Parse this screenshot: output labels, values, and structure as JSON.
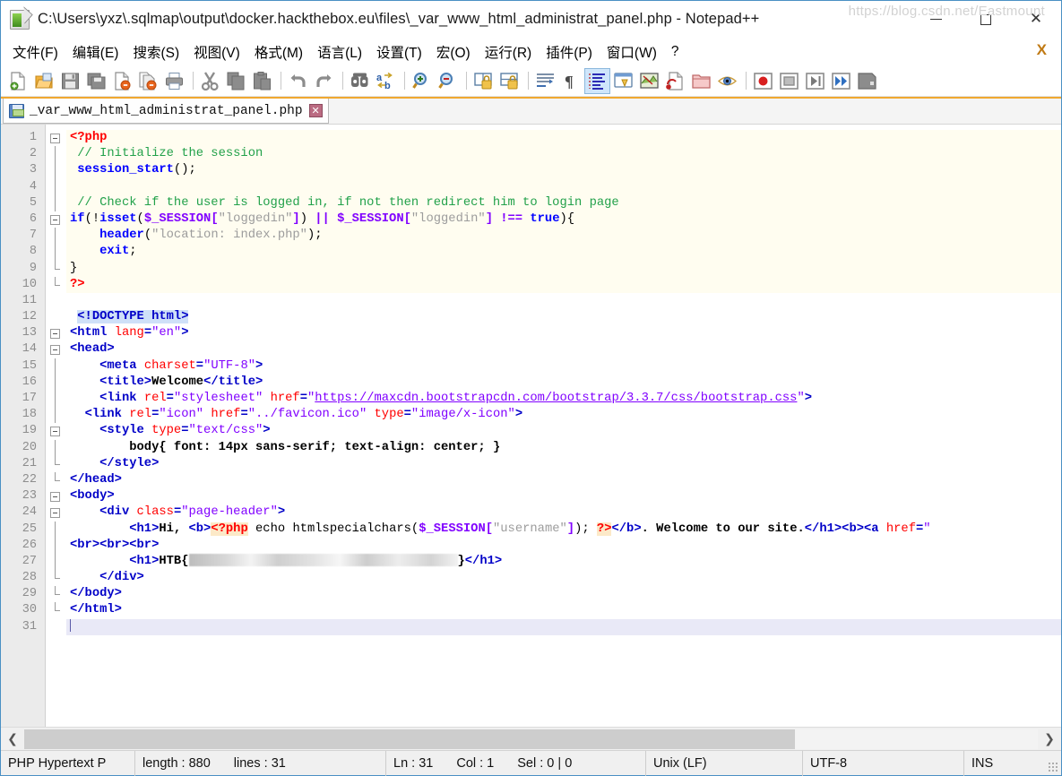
{
  "window": {
    "title": "C:\\Users\\yxz\\.sqlmap\\output\\docker.hackthebox.eu\\files\\_var_www_html_administrat_panel.php - Notepad++",
    "app_icon": "notepad-plus-plus-icon",
    "minimize_label": "Minimize",
    "maximize_label": "Maximize",
    "close_label": "Close"
  },
  "menubar": {
    "items": [
      {
        "label": "文件(F)",
        "name": "menu-file"
      },
      {
        "label": "编辑(E)",
        "name": "menu-edit"
      },
      {
        "label": "搜索(S)",
        "name": "menu-search"
      },
      {
        "label": "视图(V)",
        "name": "menu-view"
      },
      {
        "label": "格式(M)",
        "name": "menu-format"
      },
      {
        "label": "语言(L)",
        "name": "menu-language"
      },
      {
        "label": "设置(T)",
        "name": "menu-settings"
      },
      {
        "label": "宏(O)",
        "name": "menu-macro"
      },
      {
        "label": "运行(R)",
        "name": "menu-run"
      },
      {
        "label": "插件(P)",
        "name": "menu-plugins"
      },
      {
        "label": "窗口(W)",
        "name": "menu-window"
      },
      {
        "label": "?",
        "name": "menu-help"
      }
    ],
    "close_document_label": "X"
  },
  "toolbar": {
    "icons": [
      "new-file-icon",
      "open-file-icon",
      "save-icon",
      "save-all-icon",
      "close-file-icon",
      "close-all-icon",
      "print-icon",
      "cut-icon",
      "copy-icon",
      "paste-icon",
      "undo-icon",
      "redo-icon",
      "find-icon",
      "replace-icon",
      "zoom-in-icon",
      "zoom-out-icon",
      "sync-vertical-scroll-icon",
      "sync-horizontal-scroll-icon",
      "word-wrap-icon",
      "show-all-characters-icon",
      "indent-guide-icon",
      "user-defined-dialog-icon",
      "document-map-icon",
      "function-list-icon",
      "folder-as-workspace-icon",
      "monitoring-icon",
      "record-macro-icon",
      "stop-recording-icon",
      "playback-macro-icon",
      "run-macro-multiple-icon",
      "save-macro-icon"
    ]
  },
  "tab": {
    "label": "_var_www_html_administrat_panel.php",
    "icon": "saved-document-icon",
    "close_label": "✕"
  },
  "editor": {
    "total_lines": 31,
    "current_line": 31,
    "lines": [
      {
        "n": 1,
        "fold": "open",
        "tokens": [
          {
            "t": "phptag",
            "s": "<?php"
          }
        ]
      },
      {
        "n": 2,
        "fold": "bar",
        "tokens": [
          {
            "t": "plain",
            "s": " "
          },
          {
            "t": "comment",
            "s": "// Initialize the session"
          }
        ]
      },
      {
        "n": 3,
        "fold": "bar",
        "tokens": [
          {
            "t": "plain",
            "s": " "
          },
          {
            "t": "func",
            "s": "session_start"
          },
          {
            "t": "plain",
            "s": "();"
          }
        ]
      },
      {
        "n": 4,
        "fold": "bar",
        "tokens": []
      },
      {
        "n": 5,
        "fold": "bar",
        "tokens": [
          {
            "t": "plain",
            "s": " "
          },
          {
            "t": "comment",
            "s": "// Check if the user is logged in, if not then redirect him to login page"
          }
        ]
      },
      {
        "n": 6,
        "fold": "open",
        "tokens": [
          {
            "t": "kw",
            "s": "if"
          },
          {
            "t": "plain",
            "s": "(!"
          },
          {
            "t": "func",
            "s": "isset"
          },
          {
            "t": "plain",
            "s": "("
          },
          {
            "t": "var",
            "s": "$_SESSION"
          },
          {
            "t": "op",
            "s": "["
          },
          {
            "t": "str",
            "s": "\"loggedin\""
          },
          {
            "t": "op",
            "s": "]"
          },
          {
            "t": "plain",
            "s": ") "
          },
          {
            "t": "op",
            "s": "||"
          },
          {
            "t": "plain",
            "s": " "
          },
          {
            "t": "var",
            "s": "$_SESSION"
          },
          {
            "t": "op",
            "s": "["
          },
          {
            "t": "str",
            "s": "\"loggedin\""
          },
          {
            "t": "op",
            "s": "]"
          },
          {
            "t": "plain",
            "s": " "
          },
          {
            "t": "op",
            "s": "!=="
          },
          {
            "t": "plain",
            "s": " "
          },
          {
            "t": "kw",
            "s": "true"
          },
          {
            "t": "plain",
            "s": "){"
          }
        ]
      },
      {
        "n": 7,
        "fold": "bar",
        "tokens": [
          {
            "t": "plain",
            "s": "    "
          },
          {
            "t": "func",
            "s": "header"
          },
          {
            "t": "plain",
            "s": "("
          },
          {
            "t": "str",
            "s": "\"location: index.php\""
          },
          {
            "t": "plain",
            "s": ");"
          }
        ]
      },
      {
        "n": 8,
        "fold": "bar",
        "tokens": [
          {
            "t": "plain",
            "s": "    "
          },
          {
            "t": "kw",
            "s": "exit"
          },
          {
            "t": "plain",
            "s": ";"
          }
        ]
      },
      {
        "n": 9,
        "fold": "mid",
        "tokens": [
          {
            "t": "plain",
            "s": "}"
          }
        ]
      },
      {
        "n": 10,
        "fold": "end",
        "tokens": [
          {
            "t": "phptag",
            "s": "?>"
          }
        ]
      },
      {
        "n": 11,
        "fold": "none",
        "tokens": []
      },
      {
        "n": 12,
        "fold": "none",
        "tokens": [
          {
            "t": "plain",
            "s": " "
          },
          {
            "t": "doctype",
            "s": "<!DOCTYPE html>"
          }
        ]
      },
      {
        "n": 13,
        "fold": "open",
        "tokens": [
          {
            "t": "tag",
            "s": "<html "
          },
          {
            "t": "attr",
            "s": "lang"
          },
          {
            "t": "tag",
            "s": "="
          },
          {
            "t": "val",
            "s": "\"en\""
          },
          {
            "t": "tag",
            "s": ">"
          }
        ]
      },
      {
        "n": 14,
        "fold": "open",
        "tokens": [
          {
            "t": "tag",
            "s": "<head>"
          }
        ]
      },
      {
        "n": 15,
        "fold": "bar",
        "tokens": [
          {
            "t": "plain",
            "s": "    "
          },
          {
            "t": "tag",
            "s": "<meta "
          },
          {
            "t": "attr",
            "s": "charset"
          },
          {
            "t": "tag",
            "s": "="
          },
          {
            "t": "val",
            "s": "\"UTF-8\""
          },
          {
            "t": "tag",
            "s": ">"
          }
        ]
      },
      {
        "n": 16,
        "fold": "bar",
        "tokens": [
          {
            "t": "plain",
            "s": "    "
          },
          {
            "t": "tag",
            "s": "<title>"
          },
          {
            "t": "text",
            "s": "Welcome"
          },
          {
            "t": "tag",
            "s": "</title>"
          }
        ]
      },
      {
        "n": 17,
        "fold": "bar",
        "tokens": [
          {
            "t": "plain",
            "s": "    "
          },
          {
            "t": "tag",
            "s": "<link "
          },
          {
            "t": "attr",
            "s": "rel"
          },
          {
            "t": "tag",
            "s": "="
          },
          {
            "t": "val",
            "s": "\"stylesheet\""
          },
          {
            "t": "plain",
            "s": " "
          },
          {
            "t": "attr",
            "s": "href"
          },
          {
            "t": "tag",
            "s": "="
          },
          {
            "t": "val",
            "s": "\""
          },
          {
            "t": "link",
            "s": "https://maxcdn.bootstrapcdn.com/bootstrap/3.3.7/css/bootstrap.css"
          },
          {
            "t": "val",
            "s": "\""
          },
          {
            "t": "tag",
            "s": ">"
          }
        ]
      },
      {
        "n": 18,
        "fold": "bar",
        "tokens": [
          {
            "t": "plain",
            "s": "  "
          },
          {
            "t": "tag",
            "s": "<link "
          },
          {
            "t": "attr",
            "s": "rel"
          },
          {
            "t": "tag",
            "s": "="
          },
          {
            "t": "val",
            "s": "\"icon\""
          },
          {
            "t": "plain",
            "s": " "
          },
          {
            "t": "attr",
            "s": "href"
          },
          {
            "t": "tag",
            "s": "="
          },
          {
            "t": "val",
            "s": "\"../favicon.ico\""
          },
          {
            "t": "plain",
            "s": " "
          },
          {
            "t": "attr",
            "s": "type"
          },
          {
            "t": "tag",
            "s": "="
          },
          {
            "t": "val",
            "s": "\"image/x-icon\""
          },
          {
            "t": "tag",
            "s": ">"
          }
        ]
      },
      {
        "n": 19,
        "fold": "open",
        "tokens": [
          {
            "t": "plain",
            "s": "    "
          },
          {
            "t": "tag",
            "s": "<style "
          },
          {
            "t": "attr",
            "s": "type"
          },
          {
            "t": "tag",
            "s": "="
          },
          {
            "t": "val",
            "s": "\"text/css\""
          },
          {
            "t": "tag",
            "s": ">"
          }
        ]
      },
      {
        "n": 20,
        "fold": "bar2",
        "tokens": [
          {
            "t": "plain",
            "s": "        "
          },
          {
            "t": "text",
            "s": "body{ font: 14px sans-serif; text-align: center; }"
          }
        ]
      },
      {
        "n": 21,
        "fold": "mid",
        "tokens": [
          {
            "t": "plain",
            "s": "    "
          },
          {
            "t": "tag",
            "s": "</style>"
          }
        ]
      },
      {
        "n": 22,
        "fold": "mid",
        "tokens": [
          {
            "t": "tag",
            "s": "</head>"
          }
        ]
      },
      {
        "n": 23,
        "fold": "open",
        "tokens": [
          {
            "t": "tag",
            "s": "<body>"
          }
        ]
      },
      {
        "n": 24,
        "fold": "open",
        "tokens": [
          {
            "t": "plain",
            "s": "    "
          },
          {
            "t": "tag",
            "s": "<div "
          },
          {
            "t": "attr",
            "s": "class"
          },
          {
            "t": "tag",
            "s": "="
          },
          {
            "t": "val",
            "s": "\"page-header\""
          },
          {
            "t": "tag",
            "s": ">"
          }
        ]
      },
      {
        "n": 25,
        "fold": "bar2",
        "tokens": [
          {
            "t": "plain",
            "s": "        "
          },
          {
            "t": "tag",
            "s": "<h1>"
          },
          {
            "t": "text",
            "s": "Hi, "
          },
          {
            "t": "tag",
            "s": "<b>"
          },
          {
            "t": "phptag-hl",
            "s": "<?php"
          },
          {
            "t": "plain",
            "s": " echo "
          },
          {
            "t": "func2",
            "s": "htmlspecialchars"
          },
          {
            "t": "plain",
            "s": "("
          },
          {
            "t": "var",
            "s": "$_SESSION"
          },
          {
            "t": "op",
            "s": "["
          },
          {
            "t": "str",
            "s": "\"username\""
          },
          {
            "t": "op",
            "s": "]"
          },
          {
            "t": "plain",
            "s": "); "
          },
          {
            "t": "phptag-hl",
            "s": "?>"
          },
          {
            "t": "tag",
            "s": "</b>"
          },
          {
            "t": "text",
            "s": ". Welcome to our site."
          },
          {
            "t": "tag",
            "s": "</h1>"
          },
          {
            "t": "tag",
            "s": "<b>"
          },
          {
            "t": "tag",
            "s": "<a "
          },
          {
            "t": "attr",
            "s": "href"
          },
          {
            "t": "tag",
            "s": "="
          },
          {
            "t": "val",
            "s": "\""
          }
        ]
      },
      {
        "n": 26,
        "fold": "bar2",
        "tokens": [
          {
            "t": "tag",
            "s": "<br>"
          },
          {
            "t": "tag",
            "s": "<br>"
          },
          {
            "t": "tag",
            "s": "<br>"
          }
        ]
      },
      {
        "n": 27,
        "fold": "bar2",
        "tokens": [
          {
            "t": "plain",
            "s": "        "
          },
          {
            "t": "tag",
            "s": "<h1>"
          },
          {
            "t": "text",
            "s": "HTB{"
          },
          {
            "t": "redact",
            "s": "REDACTED_FLAG"
          },
          {
            "t": "text",
            "s": "}"
          },
          {
            "t": "tag",
            "s": "</h1>"
          }
        ]
      },
      {
        "n": 28,
        "fold": "mid",
        "tokens": [
          {
            "t": "plain",
            "s": "    "
          },
          {
            "t": "tag",
            "s": "</div>"
          }
        ]
      },
      {
        "n": 29,
        "fold": "mid",
        "tokens": [
          {
            "t": "tag",
            "s": "</body>"
          }
        ]
      },
      {
        "n": 30,
        "fold": "end",
        "tokens": [
          {
            "t": "tag",
            "s": "</html>"
          }
        ]
      },
      {
        "n": 31,
        "fold": "none",
        "tokens": [],
        "current": true
      }
    ]
  },
  "hscroll": {
    "left_arrow": "❮",
    "right_arrow": "❯",
    "thumb_percent": 76
  },
  "statusbar": {
    "language": "PHP Hypertext P",
    "length_label": "length : 880",
    "lines_label": "lines : 31",
    "ln_label": "Ln : 31",
    "col_label": "Col : 1",
    "sel_label": "Sel : 0 | 0",
    "eol": "Unix (LF)",
    "encoding": "UTF-8",
    "insert_mode": "INS"
  },
  "watermark": "https://blog.csdn.net/Eastmount",
  "colors": {
    "accent_orange": "#f0a830",
    "php_bg": "#fffdf0",
    "current_line_bg": "#e9e9f7",
    "tag_blue": "#0000c8",
    "attr_red": "#ff0000",
    "value_purple": "#8000ff",
    "comment_green": "#22a14a",
    "string_gray": "#9c9c9c",
    "window_border": "#4a90c4"
  }
}
